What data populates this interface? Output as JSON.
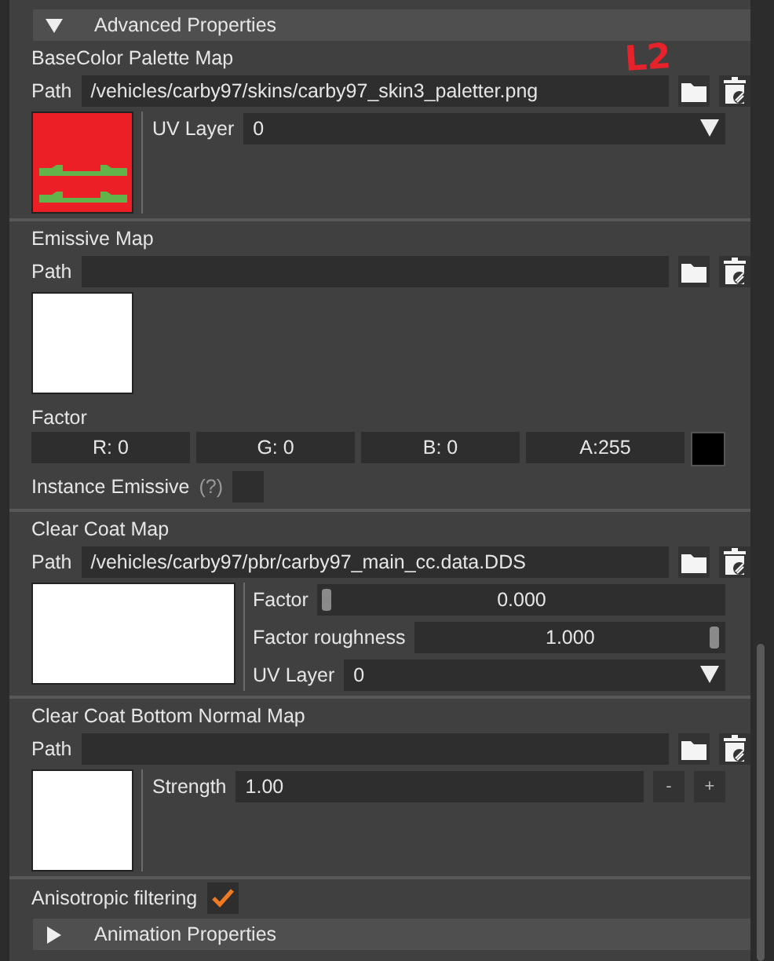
{
  "header": {
    "label": "Advanced Properties",
    "expanded": true
  },
  "annotation": "L2",
  "maps": [
    {
      "title": "BaseColor Palette Map",
      "path_label": "Path",
      "path": "/vehicles/carby97/skins/carby97_skin3_paletter.png",
      "controls": [
        {
          "kind": "dropdown",
          "label": "UV Layer",
          "value": "0"
        }
      ]
    },
    {
      "title": "Emissive Map",
      "path_label": "Path",
      "factor": {
        "label": "Factor",
        "channels": [
          "R:  0",
          "G:  0",
          "B:  0",
          "A:255"
        ],
        "color": "#000000"
      },
      "instance": {
        "label": "Instance Emissive",
        "hint": "(?)",
        "checked": false
      }
    },
    {
      "title": "Clear Coat Map",
      "path_label": "Path",
      "path": "/vehicles/carby97/pbr/carby97_main_cc.data.DDS",
      "controls": [
        {
          "kind": "slider",
          "label": "Factor",
          "value": "0.000",
          "level": 0
        },
        {
          "kind": "slider",
          "label": "Factor roughness",
          "value": "1.000",
          "level": 1
        },
        {
          "kind": "dropdown",
          "label": "UV Layer",
          "value": "0"
        }
      ]
    },
    {
      "title": "Clear Coat Bottom Normal Map",
      "path_label": "Path",
      "controls": [
        {
          "kind": "stepper",
          "label": "Strength",
          "value": "1.00",
          "minus": "-",
          "plus": "+"
        }
      ]
    }
  ],
  "anisotropic": {
    "label": "Anisotropic filtering",
    "checked": true
  },
  "footer": {
    "label": "Animation Properties",
    "expanded": false
  }
}
